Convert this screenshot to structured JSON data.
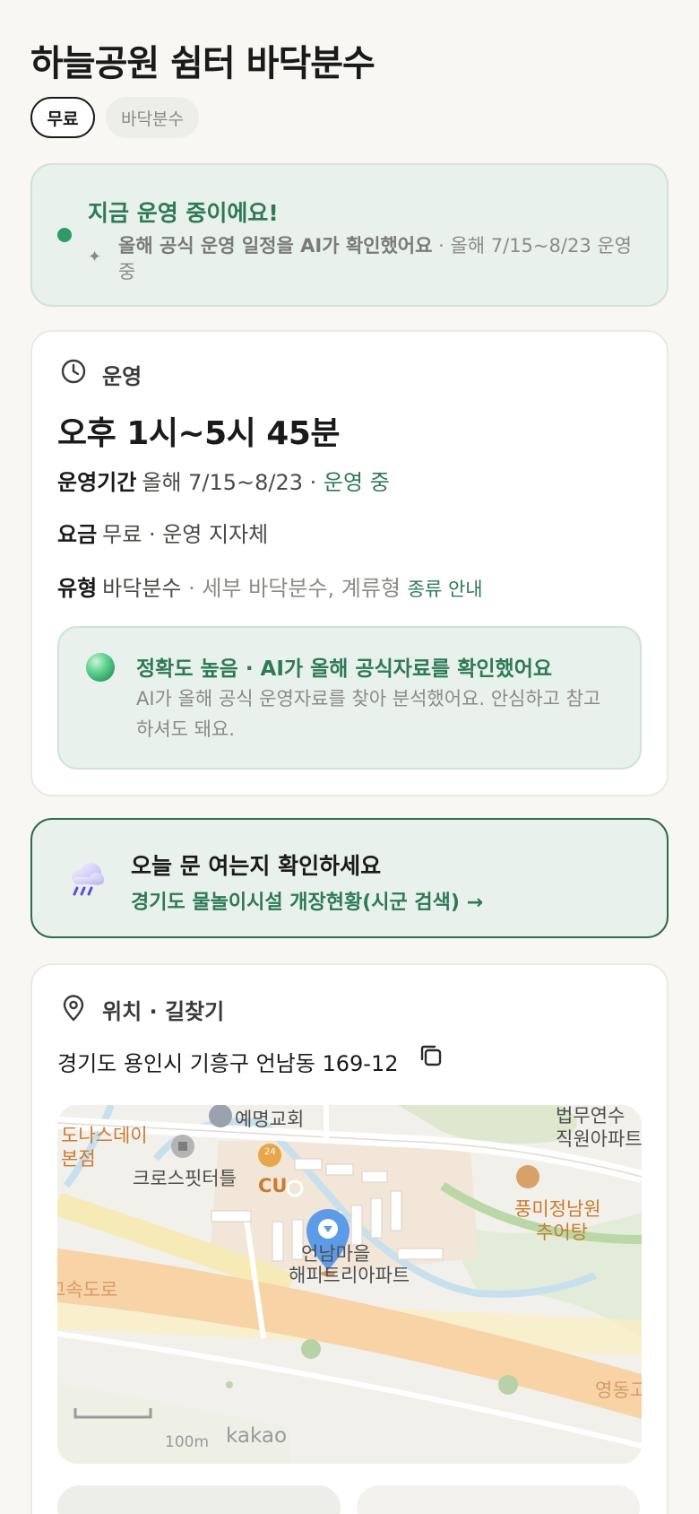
{
  "title": "하늘공원 쉼터 바닥분수",
  "chips": [
    "무료",
    "바닥분수"
  ],
  "status": {
    "title": "지금 운영 중이에요!",
    "sparkle": "✦",
    "ai_note": "올해 공식 운영 일정을 AI가 확인했어요",
    "detail": " · 올해 7/15~8/23 운영 중"
  },
  "operation": {
    "header": "운영",
    "hours": "오후 1시~5시 45분",
    "period_label": "운영기간",
    "period_value": "올해 7/15~8/23 · ",
    "period_status": "운영 중",
    "fee_label": "요금",
    "fee_value": "무료 · 운영 지자체",
    "type_label": "유형",
    "type_value": "바닥분수",
    "type_detail": " · 세부 바닥분수, 계류형 ",
    "type_link": "종류 안내",
    "accuracy_title": "정확도 높음 · AI가 올해 공식자료를 확인했어요",
    "accuracy_text": "AI가 올해 공식 운영자료를 찾아 분석했어요. 안심하고 참고하셔도 돼요."
  },
  "check": {
    "title": "오늘 문 여는지 확인하세요",
    "link": "경기도 물놀이시설 개장현황(시군 검색) →"
  },
  "location": {
    "header": "위치 · 길찾기",
    "address": "경기도 용인시 기흥구 언남동 169-12",
    "map_labels": {
      "church": "예명교회",
      "donas1": "도나스데이",
      "donas2": "본점",
      "crossfit": "크로스핏터틀",
      "cu": "CU",
      "cu_badge": "24",
      "law1": "법무연수",
      "law2": "직원아파트",
      "restaurant1": "풍미정남원",
      "restaurant2": "추어탕",
      "apt1": "언남마을",
      "apt2": "해피트리아파트",
      "highway_left": "고속도로",
      "highway_right": "영동고",
      "scale": "100m",
      "brand": "kakao"
    }
  },
  "colors": {
    "accent_green": "#2d7a55",
    "status_bg": "#e8f1ec",
    "map_orange": "#cc7a2e"
  }
}
